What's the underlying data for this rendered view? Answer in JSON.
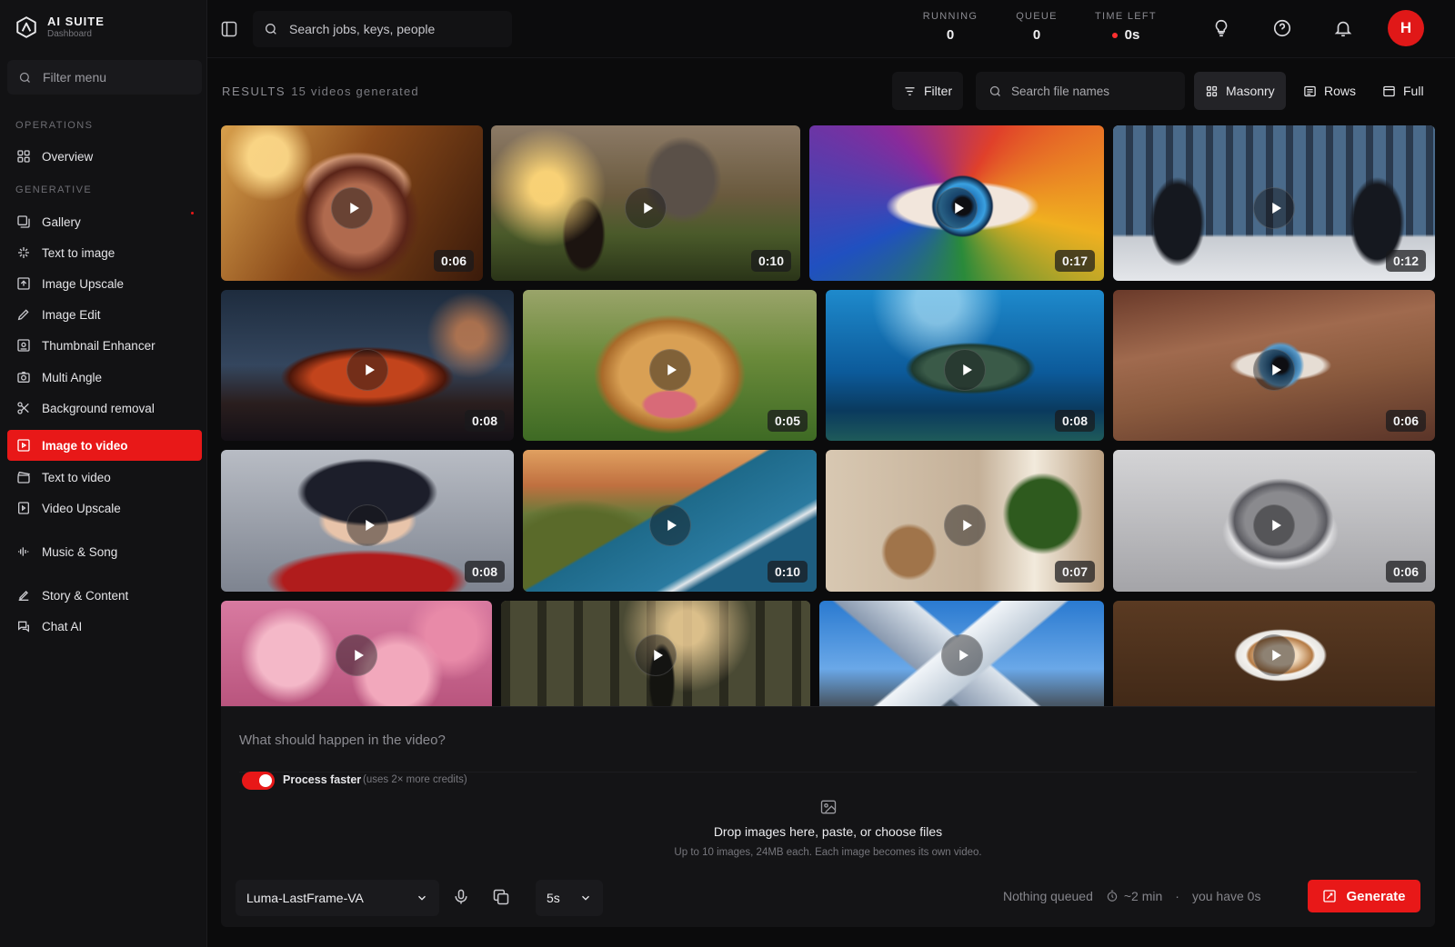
{
  "app": {
    "title": "AI SUITE",
    "subtitle": "Dashboard"
  },
  "sidebar": {
    "filter_placeholder": "Filter menu",
    "sections": {
      "operations": "OPERATIONS",
      "generative": "GENERATIVE"
    },
    "items": [
      {
        "label": "Overview",
        "icon": "grid-icon"
      },
      {
        "label": "Gallery",
        "icon": "gallery-icon"
      },
      {
        "label": "Text to image",
        "icon": "sparkle-icon"
      },
      {
        "label": "Image Upscale",
        "icon": "upscale-icon"
      },
      {
        "label": "Image Edit",
        "icon": "pen-icon"
      },
      {
        "label": "Thumbnail Enhancer",
        "icon": "thumbnail-icon"
      },
      {
        "label": "Multi Angle",
        "icon": "camera-icon"
      },
      {
        "label": "Background removal",
        "icon": "scissors-icon"
      },
      {
        "label": "Image to video",
        "icon": "image-video-icon",
        "active": true
      },
      {
        "label": "Text to video",
        "icon": "clapper-icon"
      },
      {
        "label": "Video Upscale",
        "icon": "video-upscale-icon"
      },
      {
        "label": "Music & Song",
        "icon": "waveform-icon"
      },
      {
        "label": "Story & Content",
        "icon": "pencil-icon"
      },
      {
        "label": "Chat AI",
        "icon": "chat-icon"
      }
    ]
  },
  "topbar": {
    "search_placeholder": "Search jobs, keys, people",
    "stats": [
      {
        "label": "RUNNING",
        "value": "0"
      },
      {
        "label": "QUEUE",
        "value": "0"
      },
      {
        "label": "TIME LEFT",
        "value": "0s"
      }
    ],
    "avatar_initial": "H"
  },
  "results": {
    "label": "RESULTS",
    "count_text": "15 videos generated",
    "filter_label": "Filter",
    "search_placeholder": "Search file names",
    "views": [
      "Masonry",
      "Rows",
      "Full"
    ],
    "active_view": "Masonry"
  },
  "videos": [
    {
      "subject": "woman portrait",
      "duration": "0:06"
    },
    {
      "subject": "castle landscape",
      "duration": "0:10"
    },
    {
      "subject": "colorful eye",
      "duration": "0:17"
    },
    {
      "subject": "business meeting",
      "duration": "0:12"
    },
    {
      "subject": "sports car",
      "duration": "0:08"
    },
    {
      "subject": "golden retriever",
      "duration": "0:05"
    },
    {
      "subject": "sea turtle",
      "duration": "0:08"
    },
    {
      "subject": "eye closeup",
      "duration": "0:06"
    },
    {
      "subject": "anime boy",
      "duration": "0:08"
    },
    {
      "subject": "coastal road",
      "duration": "0:10"
    },
    {
      "subject": "chair and plant",
      "duration": "0:07"
    },
    {
      "subject": "kitten",
      "duration": "0:06"
    },
    {
      "subject": "cherry blossoms",
      "duration": ""
    },
    {
      "subject": "forest figure",
      "duration": ""
    },
    {
      "subject": "snowy mountain",
      "duration": ""
    },
    {
      "subject": "latte art",
      "duration": ""
    }
  ],
  "composer": {
    "prompt_placeholder": "What should happen in the video?",
    "toggle_label": "Process faster",
    "toggle_hint": "(uses 2× more credits)",
    "toggle_on": true,
    "drop_title": "Drop images here, paste, or choose files",
    "drop_sub": "Up to 10 images, 24MB each. Each image becomes its own video.",
    "model": "Luma-LastFrame-VA",
    "duration": "5s",
    "queue_status": "Nothing queued",
    "eta": "~2 min",
    "separator": "·",
    "balance": "you have 0s",
    "generate_label": "Generate"
  },
  "colors": {
    "accent": "#e81818",
    "background": "#0b0b0c",
    "sidebar": "#121214"
  }
}
